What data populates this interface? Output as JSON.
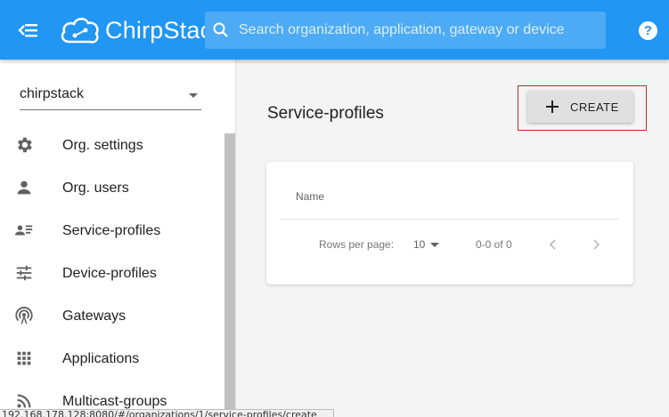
{
  "appbar": {
    "logo_text": "ChirpStack",
    "search_placeholder": "Search organization, application, gateway or device",
    "help_label": "?"
  },
  "sidebar": {
    "organization": "chirpstack",
    "items": [
      {
        "label": "Org. settings",
        "icon": "gear-icon"
      },
      {
        "label": "Org. users",
        "icon": "user-icon"
      },
      {
        "label": "Service-profiles",
        "icon": "service-profiles-icon"
      },
      {
        "label": "Device-profiles",
        "icon": "sliders-icon"
      },
      {
        "label": "Gateways",
        "icon": "antenna-icon"
      },
      {
        "label": "Applications",
        "icon": "grid-icon"
      },
      {
        "label": "Multicast-groups",
        "icon": "rss-icon"
      }
    ]
  },
  "main": {
    "title": "Service-profiles",
    "create_label": "CREATE",
    "table": {
      "columns": [
        "Name"
      ],
      "rows_per_page_label": "Rows per page:",
      "rows_per_page_value": "10",
      "range_text": "0-0 of 0"
    }
  },
  "status_url": "192.168.178.128:8080/#/organizations/1/service-profiles/create",
  "colors": {
    "appbar": "#2196f3",
    "highlight": "#c62828"
  }
}
